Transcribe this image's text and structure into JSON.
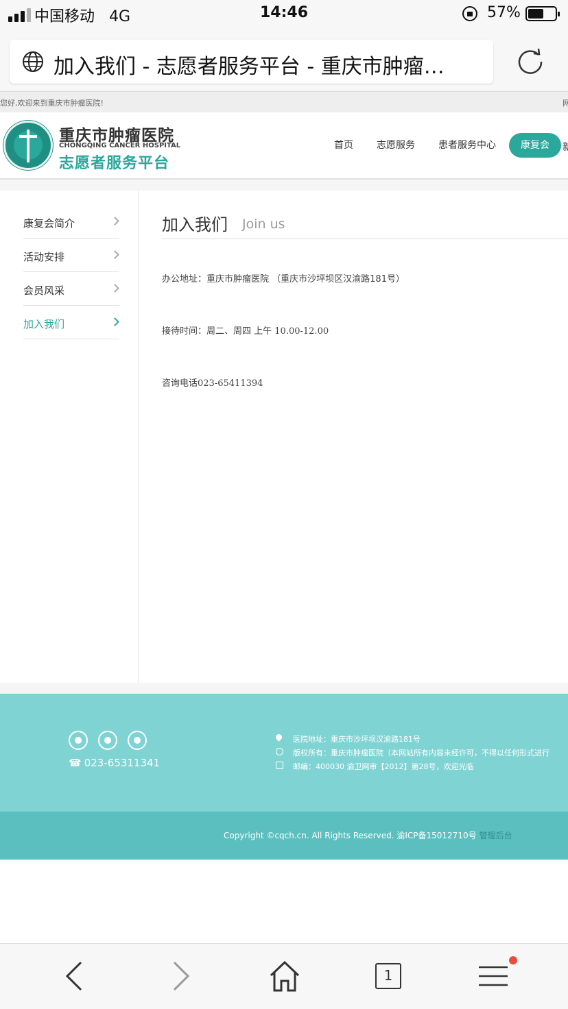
{
  "status_bar": {
    "carrier": "中国移动",
    "network": "4G",
    "time": "14:46",
    "battery_percent_label": "57%",
    "battery_level": 0.57,
    "signal_bars": 3
  },
  "browser": {
    "page_title": "加入我们 - 志愿者服务平台 - 重庆市肿瘤…",
    "tab_count": "1",
    "icons": {
      "globe": "globe-icon",
      "reload": "reload-icon",
      "back": "back-arrow-icon",
      "forward": "forward-arrow-icon",
      "home": "home-icon",
      "menu": "menu-icon"
    }
  },
  "site": {
    "welcome": "您好,欢迎来到重庆市肿瘤医院!",
    "welcome_right": "网",
    "logo": {
      "name_cn": "重庆市肿瘤医院",
      "name_en": "CHONGQING CANCER HOSPITAL",
      "subtitle": "志愿者服务平台"
    },
    "nav": {
      "items": [
        {
          "label": "首页"
        },
        {
          "label": "志愿服务"
        },
        {
          "label": "患者服务中心"
        },
        {
          "label": "康复会"
        }
      ],
      "more": "新",
      "active_index": 3
    },
    "sidebar": {
      "items": [
        {
          "label": "康复会简介"
        },
        {
          "label": "活动安排"
        },
        {
          "label": "会员风采"
        },
        {
          "label": "加入我们"
        }
      ],
      "active_index": 3
    },
    "page": {
      "title": "加入我们",
      "title_en": "Join us",
      "address_label": "办公地址：",
      "address_value": "重庆市肿瘤医院 （重庆市沙坪坝区汉渝路181号）",
      "hours_label": "接待时间：",
      "hours_days": "周二、周四 上午 ",
      "hours_time": "10.00-12.00",
      "phone_label": "咨询电话",
      "phone_value": "023-65411394"
    },
    "footer": {
      "phone": "023-65311341",
      "address": "医院地址：重庆市沙坪坝汉渝路181号",
      "rights": "版权所有：重庆市肿瘤医院（本网站所有内容未经许可，不得以任何形式进行",
      "postcode": "邮编：400030 渝卫网审【2012】第28号，欢迎光临",
      "copyright": "Copyright ©cqch.cn. All Rights Reserved. 渝ICP备15012710号",
      "admin_link": "管理后台"
    },
    "colors": {
      "accent": "#2aa89b",
      "footer_top": "#80d3d3",
      "footer_bottom": "#5cbfbf",
      "notification_dot": "#e74c3c"
    }
  }
}
